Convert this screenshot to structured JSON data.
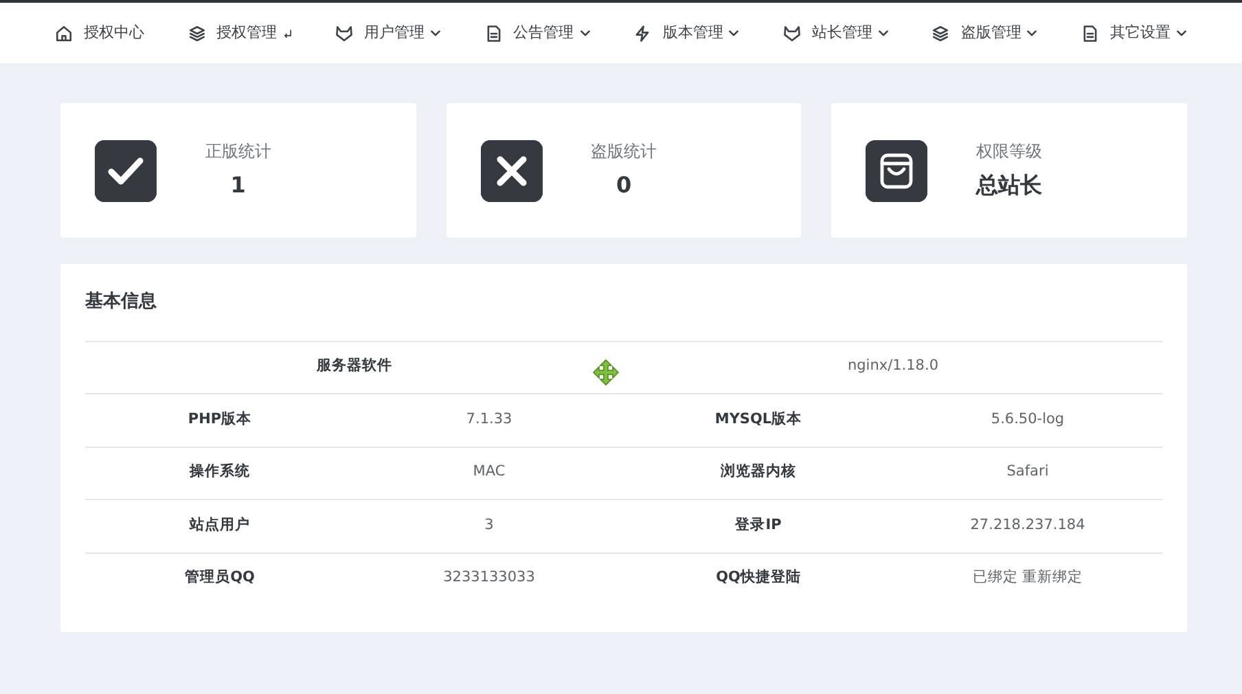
{
  "nav": [
    {
      "kind": "link",
      "label": "授权中心"
    },
    {
      "kind": "return",
      "label": "授权管理"
    },
    {
      "kind": "dropdown",
      "label": "用户管理"
    },
    {
      "kind": "dropdown",
      "label": "公告管理"
    },
    {
      "kind": "dropdown",
      "label": "版本管理"
    },
    {
      "kind": "dropdown",
      "label": "站长管理"
    },
    {
      "kind": "dropdown",
      "label": "盗版管理"
    },
    {
      "kind": "dropdown",
      "label": "其它设置"
    }
  ],
  "stats": [
    {
      "label": "正版统计",
      "value": "1"
    },
    {
      "label": "盗版统计",
      "value": "0"
    },
    {
      "label": "权限等级",
      "value": "总站长"
    }
  ],
  "info": {
    "title": "基本信息",
    "rows": [
      {
        "kind": "wide",
        "cells": [
          {
            "label": "服务器软件",
            "value": "nginx/1.18.0"
          }
        ]
      },
      {
        "kind": "pair",
        "cells": [
          {
            "label": "PHP版本",
            "value": "7.1.33"
          },
          {
            "label": "MYSQL版本",
            "value": "5.6.50-log"
          }
        ]
      },
      {
        "kind": "pair",
        "cells": [
          {
            "label": "操作系统",
            "value": "MAC"
          },
          {
            "label": "浏览器内核",
            "value": "Safari"
          }
        ]
      },
      {
        "kind": "pair",
        "cells": [
          {
            "label": "站点用户",
            "value": "3"
          },
          {
            "label": "登录IP",
            "value": "27.218.237.184"
          }
        ]
      },
      {
        "kind": "pair",
        "cells": [
          {
            "label": "管理员QQ",
            "value": "3233133033"
          },
          {
            "label": "QQ快捷登陆",
            "value": "已绑定 重新绑定"
          }
        ]
      }
    ]
  }
}
